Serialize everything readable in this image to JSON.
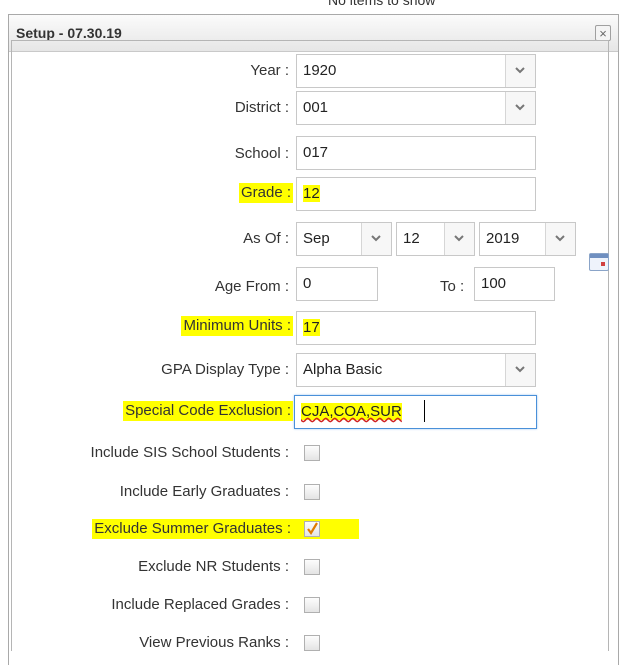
{
  "background_text": "No items to show",
  "dialog": {
    "title": "Setup - 07.30.19",
    "close_glyph": "×"
  },
  "fields": {
    "year": {
      "label": "Year :",
      "value": "1920"
    },
    "district": {
      "label": "District :",
      "value": "001"
    },
    "school": {
      "label": "School :",
      "value": "017"
    },
    "grade": {
      "label": "Grade :",
      "value": "12"
    },
    "as_of": {
      "label": "As Of :",
      "month": "Sep",
      "day": "12",
      "year": "2019"
    },
    "age_from": {
      "label": "Age From :",
      "value": "0"
    },
    "age_to": {
      "label": "To :",
      "value": "100"
    },
    "minimum_units": {
      "label": "Minimum Units :",
      "value": "17"
    },
    "gpa_display_type": {
      "label": "GPA Display Type :",
      "value": "Alpha Basic"
    },
    "special_code_exclusion": {
      "label": "Special Code Exclusion :",
      "value": "CJA,COA,SUR"
    }
  },
  "checkboxes": [
    {
      "label": "Include SIS School Students :",
      "checked": false,
      "highlight": false
    },
    {
      "label": "Include Early Graduates :",
      "checked": false,
      "highlight": false
    },
    {
      "label": "Exclude Summer Graduates :",
      "checked": true,
      "highlight": true
    },
    {
      "label": "Exclude NR Students :",
      "checked": false,
      "highlight": false
    },
    {
      "label": "Include Replaced Grades :",
      "checked": false,
      "highlight": false
    },
    {
      "label": "View Previous Ranks :",
      "checked": false,
      "highlight": false
    }
  ],
  "colors": {
    "highlight": "#ffff00",
    "focus_border": "#4a90d9",
    "check": "#e07b00"
  },
  "icons": {
    "dropdown": "chevron-down-icon",
    "calendar": "calendar-icon",
    "close": "close-icon",
    "check": "checkmark-icon"
  }
}
